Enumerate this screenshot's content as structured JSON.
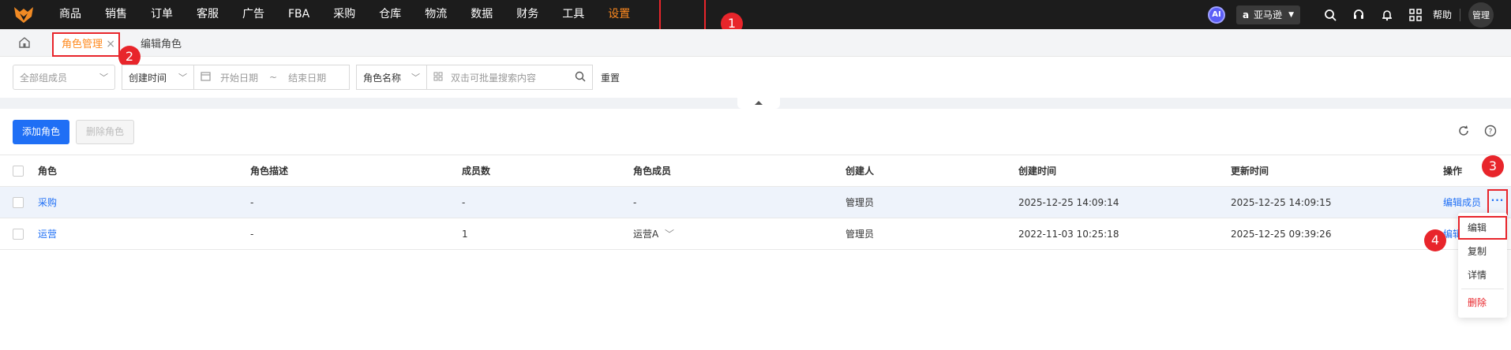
{
  "nav": {
    "items": [
      "商品",
      "销售",
      "订单",
      "客服",
      "广告",
      "FBA",
      "采购",
      "仓库",
      "物流",
      "数据",
      "财务",
      "工具",
      "设置"
    ],
    "active": "设置"
  },
  "topright": {
    "ai_label": "AI",
    "store": "亚马逊",
    "help": "帮助",
    "avatar": "管理"
  },
  "tabs": {
    "active": "角色管理",
    "close": "×",
    "other": "编辑角色"
  },
  "filters": {
    "member": "全部组成员",
    "time_type": "创建时间",
    "start_date": "开始日期",
    "date_sep": "~",
    "end_date": "结束日期",
    "field": "角色名称",
    "search_placeholder": "双击可批量搜索内容",
    "reset": "重置"
  },
  "actions": {
    "add": "添加角色",
    "delete": "删除角色"
  },
  "table": {
    "headers": [
      "角色",
      "角色描述",
      "成员数",
      "角色成员",
      "创建人",
      "创建时间",
      "更新时间",
      "操作"
    ],
    "rows": [
      {
        "role": "采购",
        "desc": "-",
        "count": "-",
        "members": "-",
        "creator": "管理员",
        "created": "2025-12-25 14:09:14",
        "updated": "2025-12-25 14:09:15",
        "op": "编辑成员"
      },
      {
        "role": "运营",
        "desc": "-",
        "count": "1",
        "members": "运营A",
        "creator": "管理员",
        "created": "2022-11-03 10:25:18",
        "updated": "2025-12-25 09:39:26",
        "op": "编辑"
      }
    ],
    "more": "···"
  },
  "menu": {
    "items": [
      "编辑",
      "复制",
      "详情",
      "删除"
    ]
  },
  "markers": [
    "1",
    "2",
    "3",
    "4"
  ],
  "colors": {
    "accent": "#ff8a1f",
    "primary": "#1f6ff5",
    "annotation": "#e8252b",
    "topbar": "#1c1c1c"
  }
}
